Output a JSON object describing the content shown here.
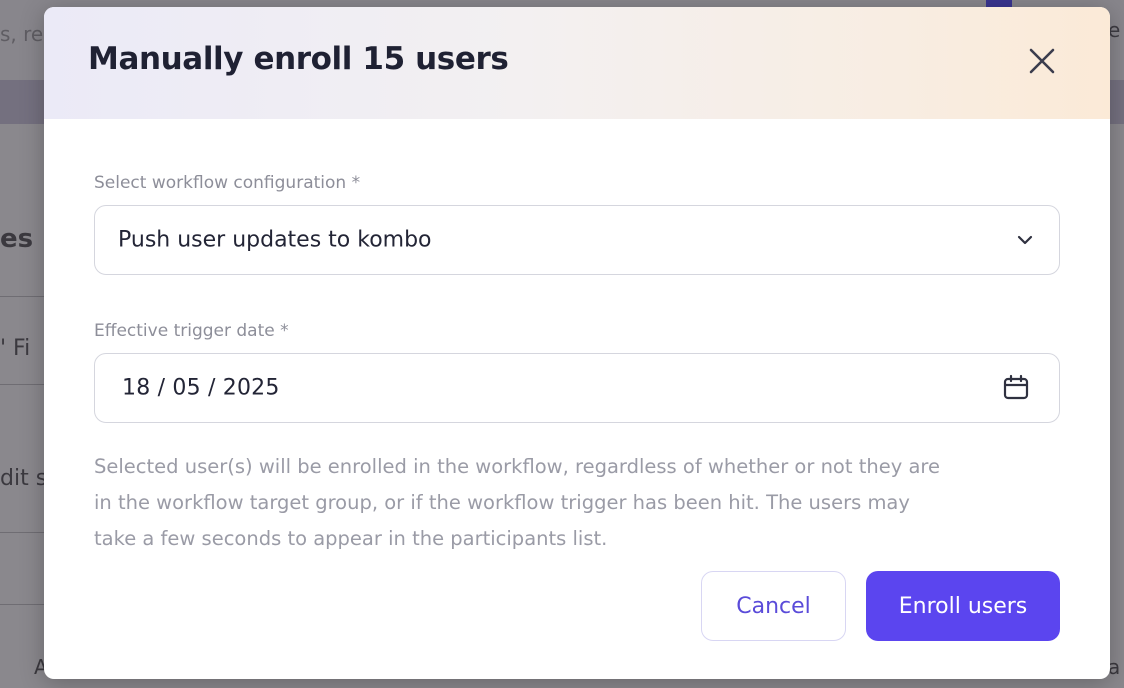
{
  "background": {
    "search_placeholder_fragment": "s, re",
    "right_top_fragment": "e",
    "left_heading_fragment": "es",
    "left_filter_fragment": "' Fi",
    "left_edit_fragment": "dit s",
    "left_bottom_fragment": "A",
    "right_bottom_fragment": "a"
  },
  "modal": {
    "title": "Manually enroll 15 users",
    "close_icon": "close-icon",
    "workflow_field": {
      "label": "Select workflow configuration *",
      "value": "Push user updates to kombo",
      "icon": "chevron-down-icon"
    },
    "date_field": {
      "label": "Effective trigger date *",
      "value": "18 / 05 / 2025",
      "icon": "calendar-icon"
    },
    "description_lines": [
      "Selected user(s) will be enrolled in the workflow, regardless of whether or not they are",
      "in the workflow target group, or if the workflow trigger has been hit. The users may",
      "take a few seconds to appear in the participants list."
    ],
    "cancel_label": "Cancel",
    "enroll_label": "Enroll users"
  },
  "colors": {
    "accent": "#5b45ef",
    "title_text": "#1f2133",
    "muted_text": "#9a9ba6",
    "overlay": "#8a888d"
  }
}
